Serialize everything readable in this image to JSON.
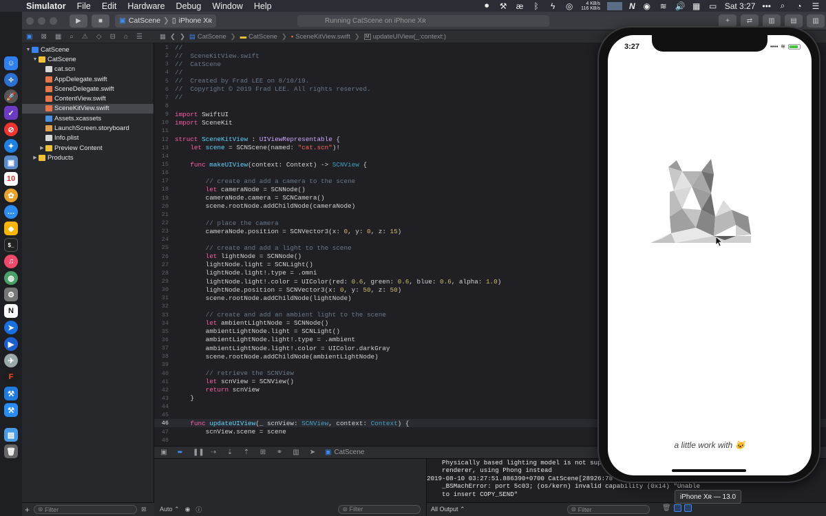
{
  "menubar": {
    "app": "Simulator",
    "items": [
      "File",
      "Edit",
      "Hardware",
      "Debug",
      "Window",
      "Help"
    ],
    "net_up": "4 KB/s",
    "net_down": "116 KB/s",
    "clock": "Sat 3:27",
    "n_label": "N",
    "more": "•••"
  },
  "toolbar": {
    "scheme": "CatScene",
    "device": "iPhone Xʀ",
    "activity": "Running CatScene on iPhone Xʀ"
  },
  "jumpbar": {
    "crumbs": [
      "CatScene",
      "CatScene",
      "SceneKitView.swift",
      "updateUIView(_:context:)"
    ]
  },
  "navigator": {
    "items": [
      {
        "label": "CatScene",
        "kind": "proj",
        "depth": 0,
        "disclosure": "▼"
      },
      {
        "label": "CatScene",
        "kind": "folder",
        "depth": 1,
        "disclosure": "▼"
      },
      {
        "label": "cat.scn",
        "kind": "plain",
        "depth": 2,
        "disclosure": ""
      },
      {
        "label": "AppDelegate.swift",
        "kind": "swift",
        "depth": 2,
        "disclosure": ""
      },
      {
        "label": "SceneDelegate.swift",
        "kind": "swift",
        "depth": 2,
        "disclosure": ""
      },
      {
        "label": "ContentView.swift",
        "kind": "swift",
        "depth": 2,
        "disclosure": ""
      },
      {
        "label": "SceneKitView.swift",
        "kind": "swift",
        "depth": 2,
        "disclosure": "",
        "selected": true
      },
      {
        "label": "Assets.xcassets",
        "kind": "assets",
        "depth": 2,
        "disclosure": ""
      },
      {
        "label": "LaunchScreen.storyboard",
        "kind": "sb",
        "depth": 2,
        "disclosure": ""
      },
      {
        "label": "Info.plist",
        "kind": "plain",
        "depth": 2,
        "disclosure": ""
      },
      {
        "label": "Preview Content",
        "kind": "folder",
        "depth": 2,
        "disclosure": "▶"
      },
      {
        "label": "Products",
        "kind": "folder",
        "depth": 1,
        "disclosure": "▶"
      }
    ],
    "filter_placeholder": "Filter"
  },
  "editor": {
    "current_line": 46,
    "lines": [
      [
        [
          "c",
          "//"
        ]
      ],
      [
        [
          "c",
          "//  SceneKitView.swift"
        ]
      ],
      [
        [
          "c",
          "//  CatScene"
        ]
      ],
      [
        [
          "c",
          "//"
        ]
      ],
      [
        [
          "c",
          "//  Created by Frad LEE on 8/10/19."
        ]
      ],
      [
        [
          "c",
          "//  Copyright © 2019 Frad LEE. All rights reserved."
        ]
      ],
      [
        [
          "c",
          "//"
        ]
      ],
      [],
      [
        [
          "k",
          "import"
        ],
        [
          "p",
          " SwiftUI"
        ]
      ],
      [
        [
          "k",
          "import"
        ],
        [
          "p",
          " SceneKit"
        ]
      ],
      [],
      [
        [
          "k",
          "struct"
        ],
        [
          "p",
          " "
        ],
        [
          "t",
          "SceneKitView"
        ],
        [
          "p",
          " : "
        ],
        [
          "ty",
          "UIViewRepresentable"
        ],
        [
          "p",
          " {"
        ]
      ],
      [
        [
          "p",
          "    "
        ],
        [
          "k",
          "let"
        ],
        [
          "p",
          " "
        ],
        [
          "t",
          "scene"
        ],
        [
          "p",
          " = SCNScene(named: "
        ],
        [
          "s",
          "\"cat.scn\""
        ],
        [
          "p",
          ")!"
        ]
      ],
      [],
      [
        [
          "p",
          "    "
        ],
        [
          "k",
          "func"
        ],
        [
          "p",
          " "
        ],
        [
          "t",
          "makeUIView"
        ],
        [
          "p",
          "(context: Context) -> "
        ],
        [
          "ft",
          "SCNView"
        ],
        [
          "p",
          " {"
        ]
      ],
      [],
      [
        [
          "p",
          "        "
        ],
        [
          "c",
          "// create and add a camera to the scene"
        ]
      ],
      [
        [
          "p",
          "        "
        ],
        [
          "k",
          "let"
        ],
        [
          "p",
          " cameraNode = SCNNode()"
        ]
      ],
      [
        [
          "p",
          "        cameraNode.camera = SCNCamera()"
        ]
      ],
      [
        [
          "p",
          "        scene.rootNode.addChildNode(cameraNode)"
        ]
      ],
      [],
      [
        [
          "p",
          "        "
        ],
        [
          "c",
          "// place the camera"
        ]
      ],
      [
        [
          "p",
          "        cameraNode.position = SCNVector3(x: "
        ],
        [
          "n",
          "0"
        ],
        [
          "p",
          ", y: "
        ],
        [
          "n",
          "0"
        ],
        [
          "p",
          ", z: "
        ],
        [
          "n",
          "15"
        ],
        [
          "p",
          ")"
        ]
      ],
      [],
      [
        [
          "p",
          "        "
        ],
        [
          "c",
          "// create and add a light to the scene"
        ]
      ],
      [
        [
          "p",
          "        "
        ],
        [
          "k",
          "let"
        ],
        [
          "p",
          " lightNode = SCNNode()"
        ]
      ],
      [
        [
          "p",
          "        lightNode.light = SCNLight()"
        ]
      ],
      [
        [
          "p",
          "        lightNode.light!.type = .omni"
        ]
      ],
      [
        [
          "p",
          "        lightNode.light!.color = UIColor(red: "
        ],
        [
          "n",
          "0.6"
        ],
        [
          "p",
          ", green: "
        ],
        [
          "n",
          "0.6"
        ],
        [
          "p",
          ", blue: "
        ],
        [
          "n",
          "0.6"
        ],
        [
          "p",
          ", alpha: "
        ],
        [
          "n",
          "1.0"
        ],
        [
          "p",
          ")"
        ]
      ],
      [
        [
          "p",
          "        lightNode.position = SCNVector3(x: "
        ],
        [
          "n",
          "0"
        ],
        [
          "p",
          ", y: "
        ],
        [
          "n",
          "50"
        ],
        [
          "p",
          ", z: "
        ],
        [
          "n",
          "50"
        ],
        [
          "p",
          ")"
        ]
      ],
      [
        [
          "p",
          "        scene.rootNode.addChildNode(lightNode)"
        ]
      ],
      [],
      [
        [
          "p",
          "        "
        ],
        [
          "c",
          "// create and add an ambient light to the scene"
        ]
      ],
      [
        [
          "p",
          "        "
        ],
        [
          "k",
          "let"
        ],
        [
          "p",
          " ambientLightNode = SCNNode()"
        ]
      ],
      [
        [
          "p",
          "        ambientLightNode.light = SCNLight()"
        ]
      ],
      [
        [
          "p",
          "        ambientLightNode.light!.type = .ambient"
        ]
      ],
      [
        [
          "p",
          "        ambientLightNode.light!.color = UIColor.darkGray"
        ]
      ],
      [
        [
          "p",
          "        scene.rootNode.addChildNode(ambientLightNode)"
        ]
      ],
      [],
      [
        [
          "p",
          "        "
        ],
        [
          "c",
          "// retrieve the SCNView"
        ]
      ],
      [
        [
          "p",
          "        "
        ],
        [
          "k",
          "let"
        ],
        [
          "p",
          " scnView = SCNView()"
        ]
      ],
      [
        [
          "p",
          "        "
        ],
        [
          "k",
          "return"
        ],
        [
          "p",
          " scnView"
        ]
      ],
      [
        [
          "p",
          "    }"
        ]
      ],
      [],
      [],
      [
        [
          "p",
          "    "
        ],
        [
          "k",
          "func"
        ],
        [
          "p",
          " "
        ],
        [
          "t",
          "updateUIView"
        ],
        [
          "p",
          "(_ scnView: "
        ],
        [
          "ft",
          "SCNView"
        ],
        [
          "p",
          ", context: "
        ],
        [
          "ft",
          "Context"
        ],
        [
          "p",
          ") {"
        ]
      ],
      [
        [
          "p",
          "        scnView.scene = scene"
        ]
      ],
      []
    ]
  },
  "debugbar": {
    "target": "CatScene"
  },
  "variables": {
    "auto_label": "Auto ⌃",
    "filter_placeholder": "Filter"
  },
  "console": {
    "lines": [
      "    Physically based lighting model is not supp",
      "    renderer, using Phong instead",
      "2019-08-10 03:27:51.886390+0700 CatScene[28926:78",
      "    _BSMachError: port 5c03; (os/kern) invalid capability (0x14) \"Unable",
      "    to insert COPY_SEND\""
    ],
    "output_selector": "All Output ⌃",
    "filter_placeholder": "Filter"
  },
  "simulator": {
    "time": "3:27",
    "caption": "a little work with 🐱",
    "battery_fraction": 0.85,
    "device_tooltip": "iPhone Xʀ — 13.0"
  },
  "colors": {
    "accent": "#3b8bf3",
    "keyword": "#fc5fa3",
    "comment": "#6c7986",
    "string": "#fc6a5d",
    "number": "#d0bf69"
  }
}
